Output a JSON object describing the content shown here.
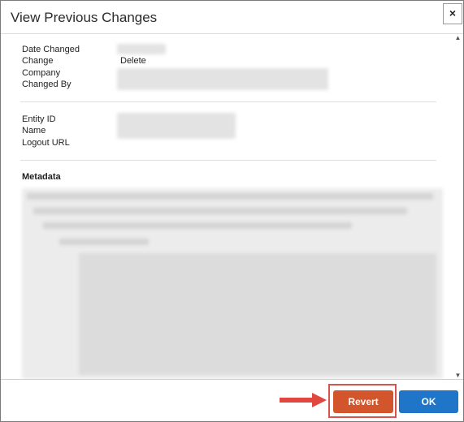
{
  "dialog": {
    "title": "View Previous Changes",
    "close_label": "×"
  },
  "change_info": {
    "labels": [
      "Date Changed",
      "Change",
      "Company",
      "Changed By"
    ],
    "change_value": "Delete"
  },
  "entity_info": {
    "labels": [
      "Entity ID",
      "Name",
      "Logout URL"
    ]
  },
  "metadata": {
    "label": "Metadata"
  },
  "footer": {
    "revert_label": "Revert",
    "ok_label": "OK"
  },
  "colors": {
    "revert": "#d2552c",
    "ok": "#1f76c9",
    "highlight": "#d9534f"
  },
  "icons": {
    "close": "close-icon",
    "arrow": "arrow-right-icon",
    "scroll_up": "chevron-up-icon",
    "scroll_down": "chevron-down-icon"
  }
}
